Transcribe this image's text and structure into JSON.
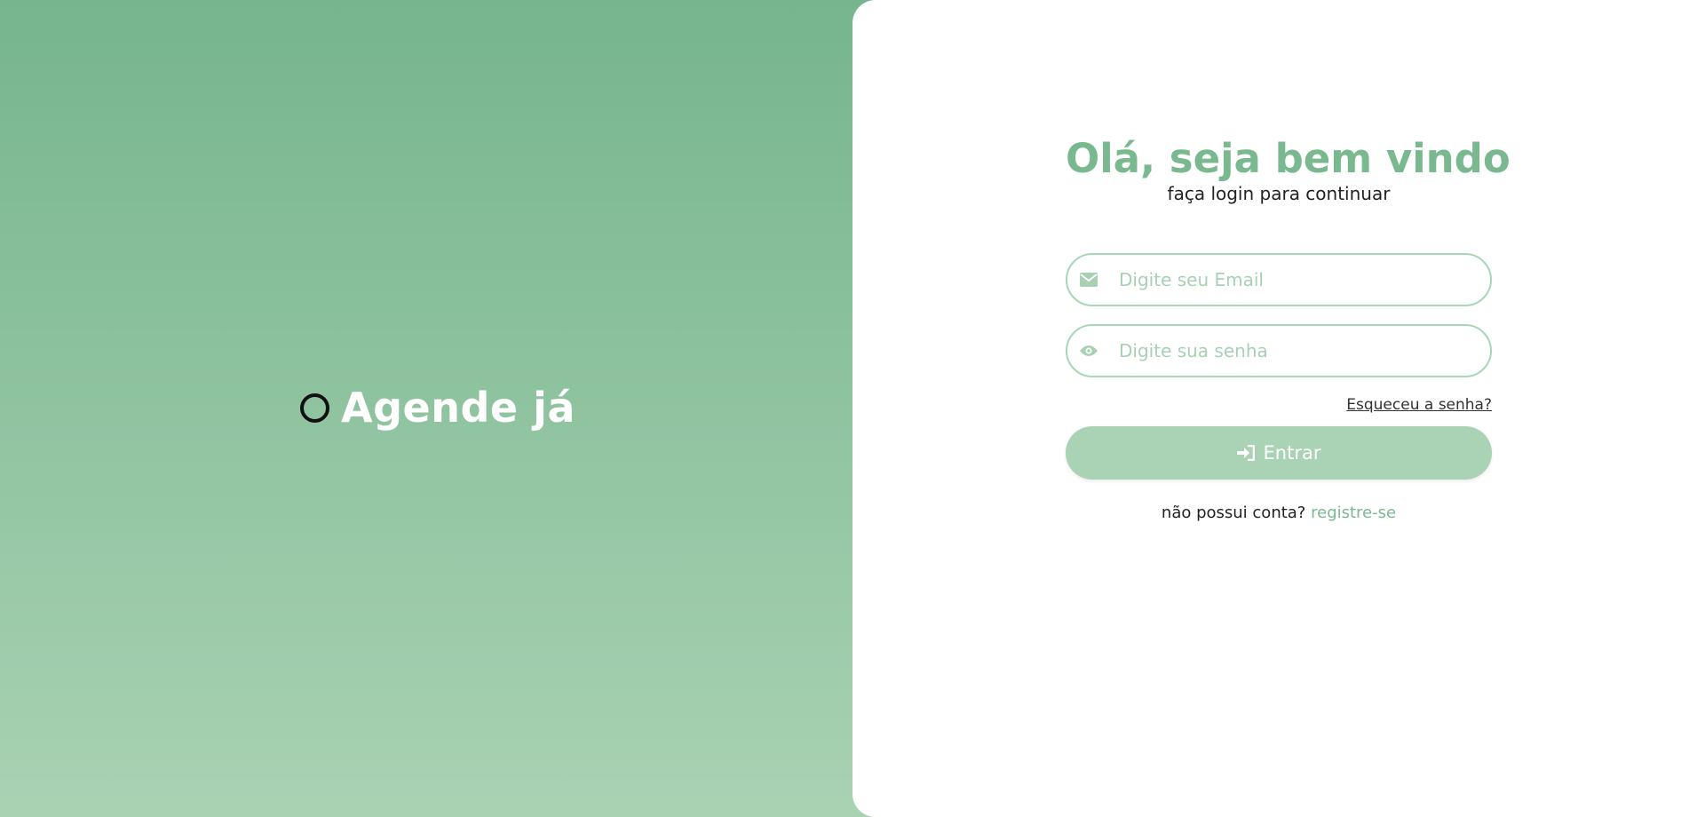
{
  "brand": {
    "name": "Agende já",
    "icon": "circle-logo-icon"
  },
  "login": {
    "title": "Olá, seja bem vindo",
    "subtitle": "faça login para continuar",
    "email": {
      "placeholder": "Digite seu Email",
      "value": "",
      "icon": "envelope-icon"
    },
    "password": {
      "placeholder": "Digite sua senha",
      "value": "",
      "icon": "eye-icon"
    },
    "forgot_label": "Esqueceu a senha?",
    "submit_label": "Entrar",
    "submit_icon": "sign-in-icon",
    "register_prompt": "não possui conta?",
    "register_link": "registre-se"
  },
  "colors": {
    "accent": "#7ab98f",
    "gradient_top": "#76b58e",
    "gradient_bottom": "#a9d2b3",
    "input_border": "#a9d6b6",
    "button_bg": "#aad2b5"
  }
}
